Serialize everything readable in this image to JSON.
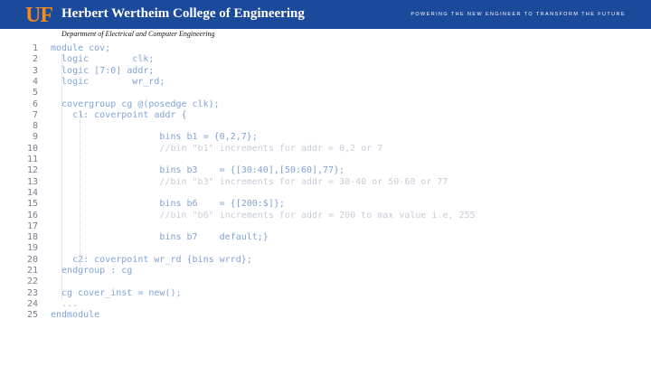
{
  "header": {
    "logo_text": "UF",
    "college_title": "Herbert Wertheim College of Engineering",
    "tagline": "POWERING THE NEW ENGINEER TO TRANSFORM THE FUTURE",
    "banner_color": "#1b4a9b",
    "logo_color": "#f28a1e"
  },
  "subtitle": "Department of Electrical and Computer Engineering",
  "code": {
    "lines": [
      {
        "n": "1",
        "text": "module cov;"
      },
      {
        "n": "2",
        "text": "  logic        clk;"
      },
      {
        "n": "3",
        "text": "  logic [7:0] addr;"
      },
      {
        "n": "4",
        "text": "  logic        wr_rd;"
      },
      {
        "n": "5",
        "text": ""
      },
      {
        "n": "6",
        "text": "  covergroup cg @(posedge clk);"
      },
      {
        "n": "7",
        "text": "    c1: coverpoint addr {"
      },
      {
        "n": "8",
        "text": ""
      },
      {
        "n": "9",
        "text": "                    bins b1 = {0,2,7};"
      },
      {
        "n": "10",
        "text": "                    //bin \"b1\" increments for addr = 0,2 or 7"
      },
      {
        "n": "11",
        "text": ""
      },
      {
        "n": "12",
        "text": "                    bins b3    = {[30:40],[50:60],77};"
      },
      {
        "n": "13",
        "text": "                    //bin \"b3\" increments for addr = 30-40 or 50-60 or 77"
      },
      {
        "n": "14",
        "text": ""
      },
      {
        "n": "15",
        "text": "                    bins b6    = {[200:$]};"
      },
      {
        "n": "16",
        "text": "                    //bin \"b6\" increments for addr = 200 to max value i.e, 255"
      },
      {
        "n": "17",
        "text": ""
      },
      {
        "n": "18",
        "text": "                    bins b7    default;}"
      },
      {
        "n": "19",
        "text": ""
      },
      {
        "n": "20",
        "text": "    c2: coverpoint wr_rd {bins wrrd};"
      },
      {
        "n": "21",
        "text": "  endgroup : cg"
      },
      {
        "n": "22",
        "text": ""
      },
      {
        "n": "23",
        "text": "  cg cover_inst = new();"
      },
      {
        "n": "24",
        "text": "  ..."
      },
      {
        "n": "25",
        "text": "endmodule"
      }
    ]
  }
}
